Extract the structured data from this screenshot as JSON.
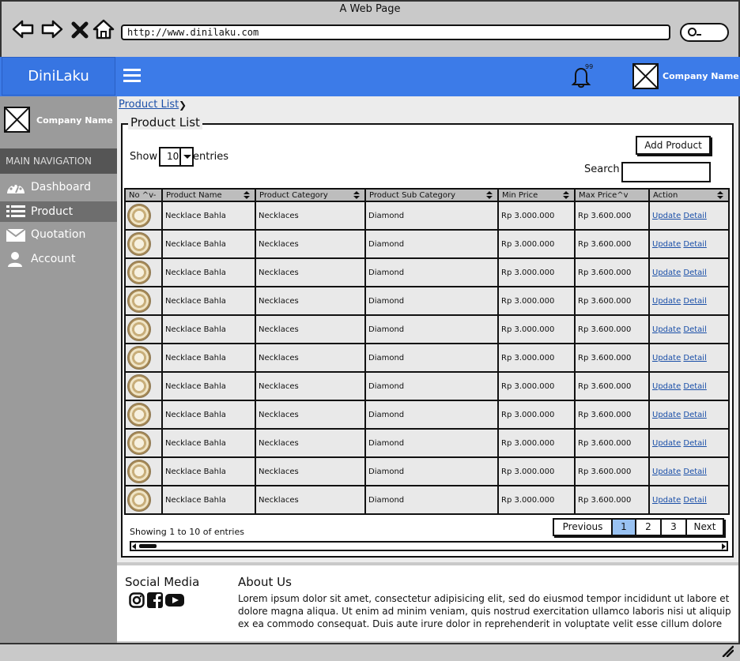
{
  "browser": {
    "title": "A Web Page",
    "url": "http://www.dinilaku.com"
  },
  "header": {
    "brand": "DiniLaku",
    "notification_count": "99",
    "company_name": "Company Name"
  },
  "sidebar": {
    "company_name": "Company Name",
    "section_title": "MAIN NAVIGATION",
    "items": [
      {
        "label": "Dashboard",
        "icon": "dashboard-icon"
      },
      {
        "label": "Product",
        "icon": "list-icon"
      },
      {
        "label": "Quotation",
        "icon": "envelope-icon"
      },
      {
        "label": "Account",
        "icon": "user-icon"
      }
    ]
  },
  "breadcrumb": {
    "current": "Product List"
  },
  "panel": {
    "title": "Product List",
    "show_label": "Show",
    "entries_value": "10",
    "entries_label": "entries",
    "add_button": "Add Product",
    "search_label": "Search",
    "search_value": ""
  },
  "table": {
    "headers": [
      "No ^v-",
      "Product Name",
      "Product Category",
      "Product Sub Category",
      "Min Price",
      "Max Price^v",
      "Action"
    ],
    "rows": [
      {
        "name": "Necklace Bahla",
        "category": "Necklaces",
        "subcategory": "Diamond",
        "min": "Rp 3.000.000",
        "max": "Rp 3.600.000",
        "update": "Update",
        "detail": "Detail"
      },
      {
        "name": "Necklace Bahla",
        "category": "Necklaces",
        "subcategory": "Diamond",
        "min": "Rp 3.000.000",
        "max": "Rp 3.600.000",
        "update": "Update",
        "detail": "Detail"
      },
      {
        "name": "Necklace Bahla",
        "category": "Necklaces",
        "subcategory": "Diamond",
        "min": "Rp 3.000.000",
        "max": "Rp 3.600.000",
        "update": "Update",
        "detail": "Detail"
      },
      {
        "name": "Necklace Bahla",
        "category": "Necklaces",
        "subcategory": "Diamond",
        "min": "Rp 3.000.000",
        "max": "Rp 3.600.000",
        "update": "Update",
        "detail": "Detail"
      },
      {
        "name": "Necklace Bahla",
        "category": "Necklaces",
        "subcategory": "Diamond",
        "min": "Rp 3.000.000",
        "max": "Rp 3.600.000",
        "update": "Update",
        "detail": "Detail"
      },
      {
        "name": "Necklace Bahla",
        "category": "Necklaces",
        "subcategory": "Diamond",
        "min": "Rp 3.000.000",
        "max": "Rp 3.600.000",
        "update": "Update",
        "detail": "Detail"
      },
      {
        "name": "Necklace Bahla",
        "category": "Necklaces",
        "subcategory": "Diamond",
        "min": "Rp 3.000.000",
        "max": "Rp 3.600.000",
        "update": "Update",
        "detail": "Detail"
      },
      {
        "name": "Necklace Bahla",
        "category": "Necklaces",
        "subcategory": "Diamond",
        "min": "Rp 3.000.000",
        "max": "Rp 3.600.000",
        "update": "Update",
        "detail": "Detail"
      },
      {
        "name": "Necklace Bahla",
        "category": "Necklaces",
        "subcategory": "Diamond",
        "min": "Rp 3.000.000",
        "max": "Rp 3.600.000",
        "update": "Update",
        "detail": "Detail"
      },
      {
        "name": "Necklace Bahla",
        "category": "Necklaces",
        "subcategory": "Diamond",
        "min": "Rp 3.000.000",
        "max": "Rp 3.600.000",
        "update": "Update",
        "detail": "Detail"
      },
      {
        "name": "Necklace Bahla",
        "category": "Necklaces",
        "subcategory": "Diamond",
        "min": "Rp 3.000.000",
        "max": "Rp 3.600.000",
        "update": "Update",
        "detail": "Detail"
      }
    ]
  },
  "pagination": {
    "summary": "Showing 1 to 10 of entries",
    "previous": "Previous",
    "pages": [
      "1",
      "2",
      "3"
    ],
    "active_page": "1",
    "next": "Next"
  },
  "footer": {
    "social_title": "Social Media",
    "social_icons": [
      "instagram-icon",
      "facebook-icon",
      "youtube-icon"
    ],
    "about_title": "About Us",
    "about_text": "Lorem ipsum dolor sit amet, consectetur adipisicing elit, sed do eiusmod tempor incididunt ut labore et dolore magna aliqua. Ut enim ad minim veniam, quis nostrud exercitation ullamco laboris nisi ut aliquip ex ea commodo consequat. Duis aute irure dolor in reprehenderit in voluptate velit esse cillum dolore"
  },
  "colors": {
    "header_blue": "#3c7be8",
    "sidebar_gray": "#9b9b9b",
    "active_page": "#99c2f2",
    "link": "#1a4fa8"
  }
}
